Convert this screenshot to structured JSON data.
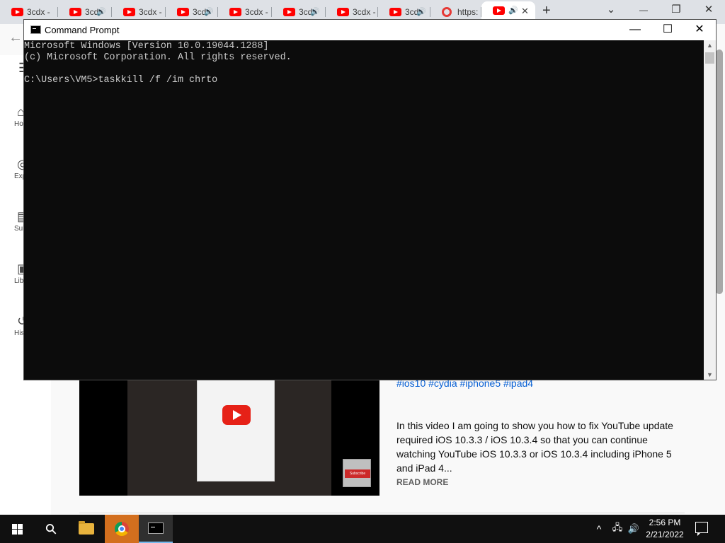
{
  "browser": {
    "tabs": [
      {
        "title": "3cdx -",
        "speaker": false
      },
      {
        "title": "3cd",
        "speaker": true
      },
      {
        "title": "3cdx -",
        "speaker": false
      },
      {
        "title": "3cd",
        "speaker": true
      },
      {
        "title": "3cdx -",
        "speaker": false
      },
      {
        "title": "3cd",
        "speaker": true
      },
      {
        "title": "3cdx -",
        "speaker": false
      },
      {
        "title": "3cd",
        "speaker": true
      },
      {
        "title": "https:",
        "speaker": false
      },
      {
        "title": "",
        "speaker": true,
        "active": true
      }
    ],
    "speaker_glyph": "🔊",
    "close_glyph": "✕",
    "new_tab_glyph": "+",
    "tab_search_glyph": "⌄",
    "minimize_glyph": "—",
    "restore_glyph": "❐",
    "window_close_glyph": "✕",
    "back_glyph": "←"
  },
  "youtube": {
    "menu_glyph": "☰",
    "sidebar": [
      {
        "icon": "home-icon",
        "glyph": "⌂",
        "label": "Ho"
      },
      {
        "icon": "explore-icon",
        "glyph": "◎",
        "label": "Exp"
      },
      {
        "icon": "subscriptions-icon",
        "glyph": "▤",
        "label": "Subsc"
      },
      {
        "icon": "library-icon",
        "glyph": "▣",
        "label": "Lib"
      },
      {
        "icon": "history-icon",
        "glyph": "↺",
        "label": "His"
      }
    ],
    "video": {
      "hashtags": "#ios10 #cydia #iphone5 #ipad4",
      "description": "In this video I am going to show you how to fix YouTube update required iOS 10.3.3 / iOS 10.3.4 so that you can continue watching YouTube iOS 10.3.3 or iOS 10.3.4 including iPhone 5 and iPad 4...",
      "read_more": "READ MORE",
      "badge_text": "Subscribe"
    }
  },
  "cmd": {
    "title": "Command Prompt",
    "lines": [
      "Microsoft Windows [Version 10.0.19044.1288]",
      "(c) Microsoft Corporation. All rights reserved.",
      "",
      "C:\\Users\\VM5>taskkill /f /im chrto"
    ],
    "minimize_glyph": "—",
    "maximize_glyph": "☐",
    "close_glyph": "✕",
    "scroll_up_glyph": "▲",
    "scroll_down_glyph": "▼"
  },
  "taskbar": {
    "search_glyph": "⚲",
    "tray_chevron": "^",
    "network_glyph": "🖧",
    "volume_glyph": "🔊",
    "time": "2:56 PM",
    "date": "2/21/2022",
    "accent_chrome": "#d36f1e",
    "accent_active": "#76b9ed"
  }
}
